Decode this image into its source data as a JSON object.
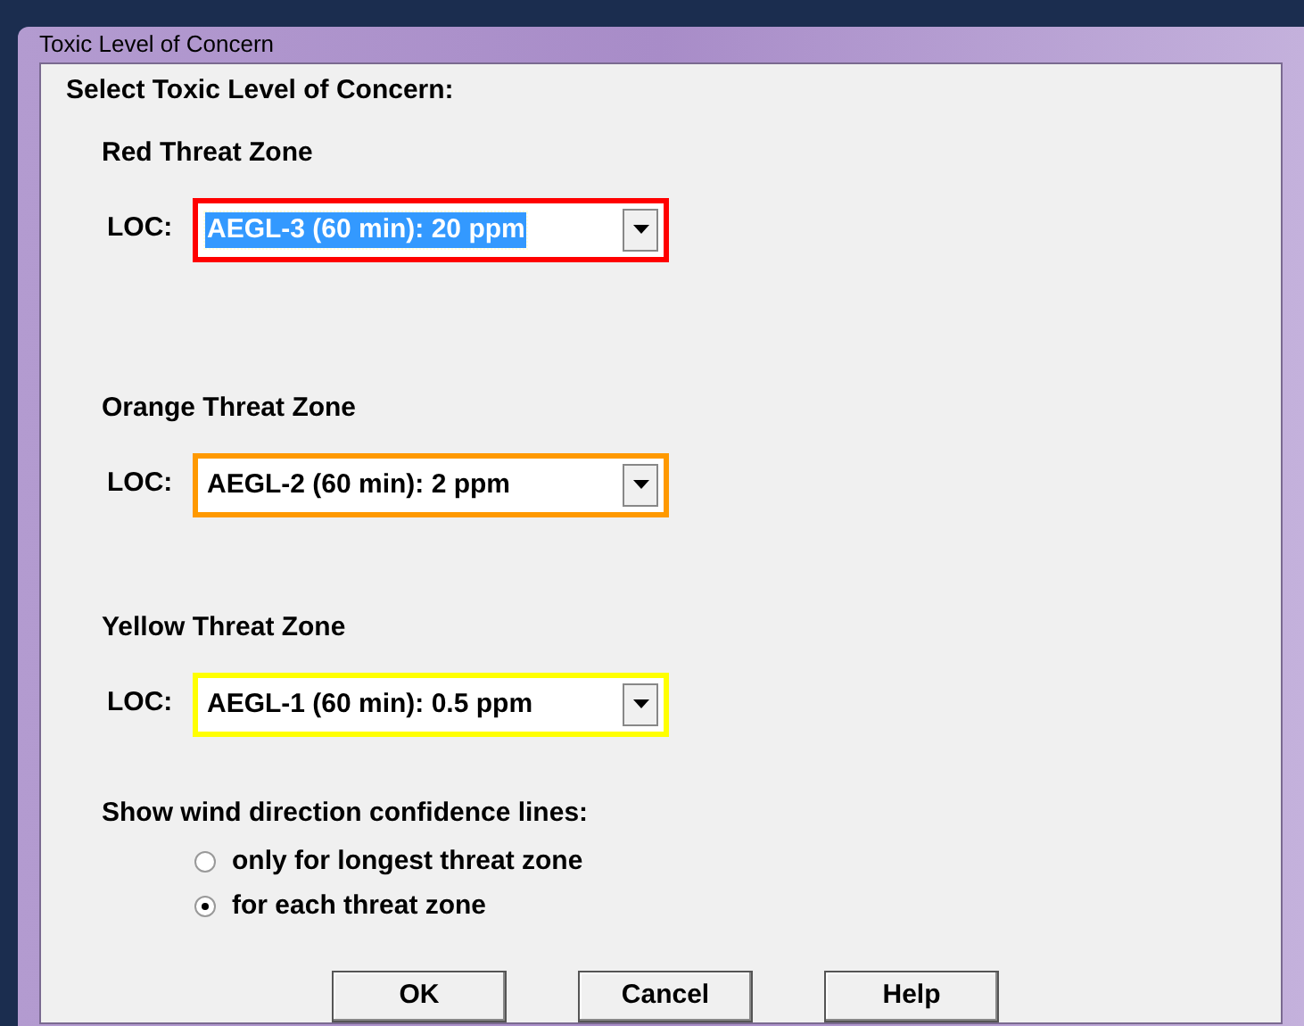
{
  "window": {
    "title": "Toxic Level of Concern"
  },
  "heading": "Select Toxic Level of Concern:",
  "zones": [
    {
      "title": "Red Threat Zone",
      "label": "LOC:",
      "value": "AEGL-3 (60 min): 20 ppm",
      "color": "#ff0000",
      "focused": true
    },
    {
      "title": "Orange Threat Zone",
      "label": "LOC:",
      "value": "AEGL-2 (60 min): 2 ppm",
      "color": "#ff9900",
      "focused": false
    },
    {
      "title": "Yellow Threat Zone",
      "label": "LOC:",
      "value": "AEGL-1 (60 min): 0.5 ppm",
      "color": "#ffff00",
      "focused": false
    }
  ],
  "wind_lines": {
    "label": "Show wind direction confidence lines:",
    "options": [
      {
        "label": "only for longest threat zone",
        "selected": false
      },
      {
        "label": "for each threat zone",
        "selected": true
      }
    ]
  },
  "buttons": [
    "OK",
    "Cancel",
    "Help"
  ]
}
